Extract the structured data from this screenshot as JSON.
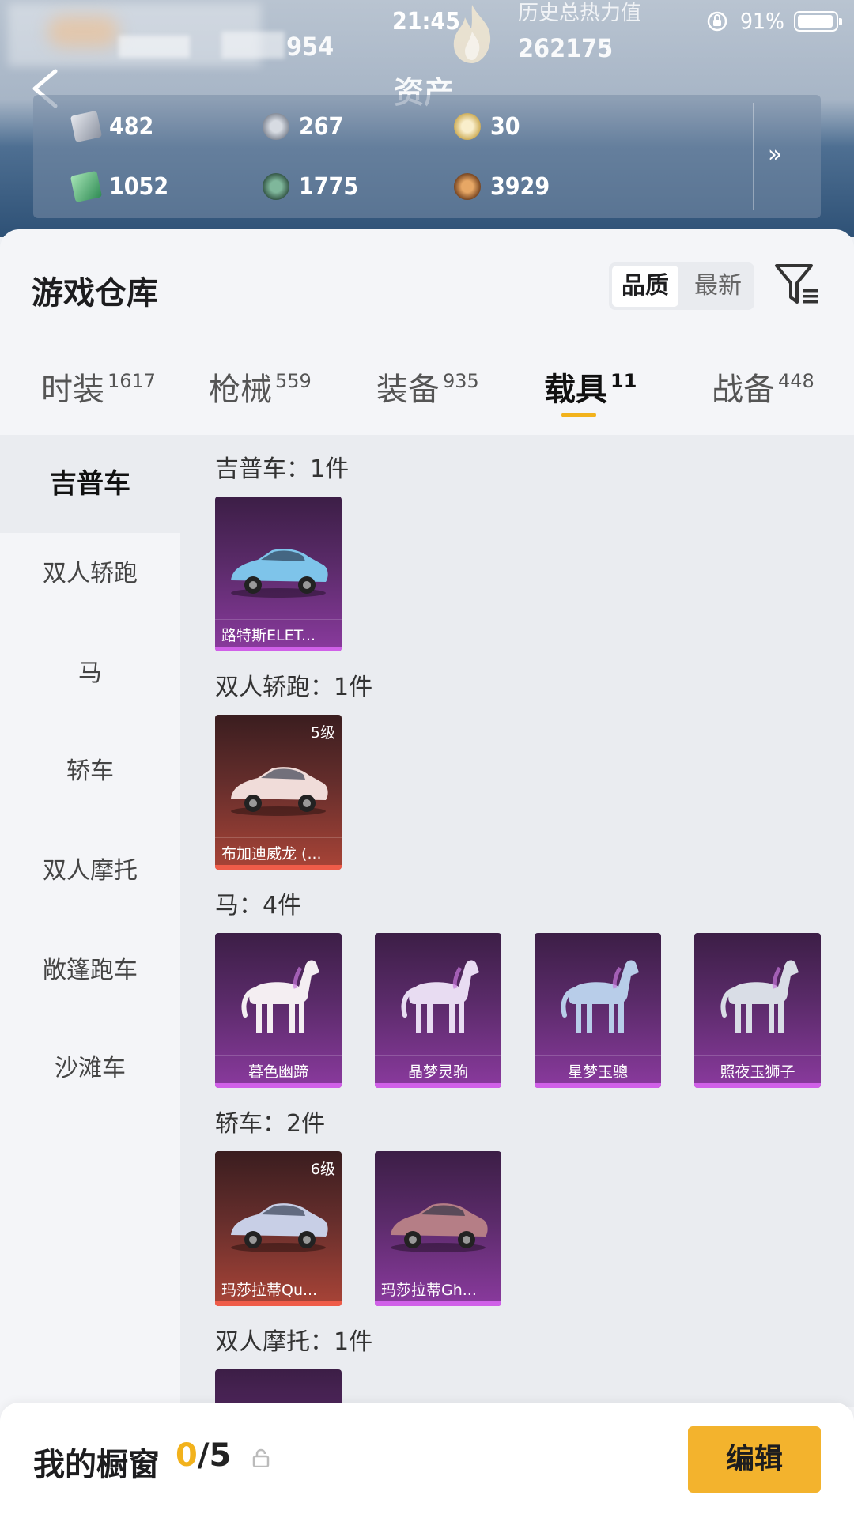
{
  "status_bar": {
    "time": "21:45",
    "battery": "91%"
  },
  "header": {
    "title": "资产",
    "player_score": "954",
    "total_heat_label": "历史总热力值",
    "total_heat_value": "262175",
    "help": "?"
  },
  "assets": [
    {
      "icon": "silver-crate-icon",
      "value": "482"
    },
    {
      "icon": "silver-coin-icon",
      "value": "267"
    },
    {
      "icon": "gold-coin-icon",
      "value": "30"
    },
    {
      "icon": "green-card-icon",
      "value": "1052"
    },
    {
      "icon": "green-medal-icon",
      "value": "1775"
    },
    {
      "icon": "bronze-medal-icon",
      "value": "3929"
    }
  ],
  "warehouse": {
    "title": "游戏仓库",
    "sort_options": [
      "品质",
      "最新"
    ],
    "active_sort": "品质"
  },
  "category_tabs": [
    {
      "label": "时装",
      "count": "1617"
    },
    {
      "label": "枪械",
      "count": "559"
    },
    {
      "label": "装备",
      "count": "935"
    },
    {
      "label": "载具",
      "count": "11"
    },
    {
      "label": "战备",
      "count": "448"
    }
  ],
  "active_tab": "载具",
  "side_nav": [
    "吉普车",
    "双人轿跑",
    "马",
    "轿车",
    "双人摩托",
    "敞篷跑车",
    "沙滩车"
  ],
  "groups": [
    {
      "title": "吉普车：1件",
      "items": [
        {
          "name": "路特斯ELET...",
          "rarity": "purple",
          "level": "",
          "kind": "car",
          "color": "#7ec4ea"
        }
      ]
    },
    {
      "title": "双人轿跑：1件",
      "items": [
        {
          "name": "布加迪威龙 (...",
          "rarity": "red",
          "level": "5级",
          "kind": "car",
          "color": "#f0dcd9"
        }
      ]
    },
    {
      "title": "马：4件",
      "items": [
        {
          "name": "暮色幽蹄",
          "rarity": "purple",
          "level": "",
          "kind": "horse",
          "color": "#f4eef2"
        },
        {
          "name": "晶梦灵驹",
          "rarity": "purple",
          "level": "",
          "kind": "horse",
          "color": "#e8dcf2"
        },
        {
          "name": "星梦玉骢",
          "rarity": "purple",
          "level": "",
          "kind": "horse",
          "color": "#b8cde9"
        },
        {
          "name": "照夜玉狮子",
          "rarity": "purple",
          "level": "",
          "kind": "horse",
          "color": "#d9dde6"
        }
      ]
    },
    {
      "title": "轿车：2件",
      "items": [
        {
          "name": "玛莎拉蒂Qu...",
          "rarity": "red",
          "level": "6级",
          "kind": "car",
          "color": "#c8cfe6"
        },
        {
          "name": "玛莎拉蒂Gh...",
          "rarity": "purple",
          "level": "",
          "kind": "car",
          "color": "#b57e86"
        }
      ]
    },
    {
      "title": "双人摩托：1件",
      "items": [
        {
          "name": "",
          "rarity": "purple",
          "level": "",
          "kind": "moto",
          "color": "#888"
        }
      ]
    }
  ],
  "showcase": {
    "label": "我的橱窗",
    "current": "0",
    "total": "/5",
    "edit_label": "编辑"
  }
}
